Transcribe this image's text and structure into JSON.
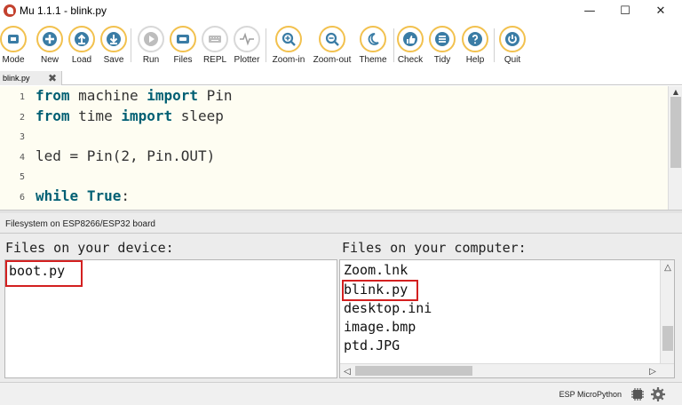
{
  "window": {
    "title": "Mu 1.1.1 - blink.py",
    "minimize_glyph": "—",
    "maximize_glyph": "☐",
    "close_glyph": "✕"
  },
  "toolbar": {
    "accent": "#f2c14e",
    "buttons": [
      {
        "label": "Mode",
        "icon": "mode-icon"
      },
      {
        "label": "New",
        "icon": "plus-icon"
      },
      {
        "label": "Load",
        "icon": "upload-icon"
      },
      {
        "label": "Save",
        "icon": "download-icon"
      },
      {
        "label": "Run",
        "icon": "play-icon",
        "enabled": false
      },
      {
        "label": "Files",
        "icon": "files-icon"
      },
      {
        "label": "REPL",
        "icon": "keyboard-icon",
        "enabled": false
      },
      {
        "label": "Plotter",
        "icon": "pulse-icon",
        "enabled": false
      },
      {
        "label": "Zoom-in",
        "icon": "zoom-in-icon"
      },
      {
        "label": "Zoom-out",
        "icon": "zoom-out-icon"
      },
      {
        "label": "Theme",
        "icon": "moon-icon"
      },
      {
        "label": "Check",
        "icon": "thumbs-up-icon"
      },
      {
        "label": "Tidy",
        "icon": "list-icon"
      },
      {
        "label": "Help",
        "icon": "question-icon"
      },
      {
        "label": "Quit",
        "icon": "power-icon"
      }
    ]
  },
  "tabs": [
    {
      "label": "blink.py",
      "close_glyph": "✖"
    }
  ],
  "editor": {
    "background": "#fefdf2",
    "keyword_color": "#005f73",
    "lines": [
      {
        "number": "1",
        "segments": [
          {
            "text": "from",
            "kw": true
          },
          {
            "text": " machine "
          },
          {
            "text": "import",
            "kw": true
          },
          {
            "text": " Pin"
          }
        ]
      },
      {
        "number": "2",
        "segments": [
          {
            "text": "from",
            "kw": true
          },
          {
            "text": " time "
          },
          {
            "text": "import",
            "kw": true
          },
          {
            "text": " sleep"
          }
        ]
      },
      {
        "number": "3",
        "segments": []
      },
      {
        "number": "4",
        "segments": [
          {
            "text": "led = Pin(2, Pin.OUT)"
          }
        ]
      },
      {
        "number": "5",
        "segments": []
      },
      {
        "number": "6",
        "segments": [
          {
            "text": "while",
            "kw": true
          },
          {
            "text": " "
          },
          {
            "text": "True",
            "kw": true
          },
          {
            "text": ":"
          }
        ]
      }
    ]
  },
  "filesystem": {
    "heading": "Filesystem on ESP8266/ESP32 board",
    "device_title": "Files on your device:",
    "computer_title": "Files on your computer:",
    "device_files": [
      "boot.py"
    ],
    "computer_files": [
      "Zoom.lnk",
      "blink.py",
      "desktop.ini",
      "image.bmp",
      "ptd.JPG"
    ],
    "highlight_color": "#d32020"
  },
  "statusbar": {
    "mode": "ESP MicroPython",
    "chip_icon": "chip-icon",
    "settings_icon": "gear-icon"
  }
}
